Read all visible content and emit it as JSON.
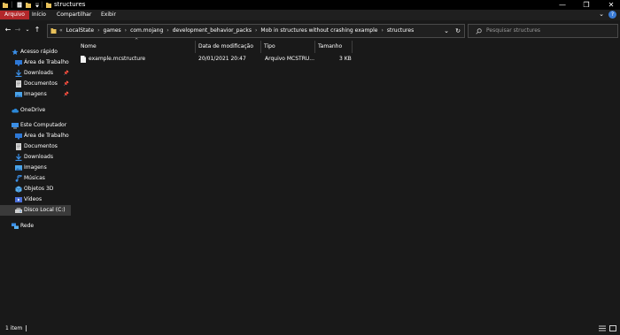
{
  "window": {
    "title": "structures",
    "controls": {
      "minimize": "—",
      "maximize": "❐",
      "close": "✕"
    }
  },
  "ribbon": {
    "tabs": [
      {
        "label": "Arquivo",
        "active": true
      },
      {
        "label": "Início"
      },
      {
        "label": "Compartilhar"
      },
      {
        "label": "Exibir"
      }
    ],
    "help_label": "?"
  },
  "nav": {
    "back": "←",
    "forward": "→",
    "recent": "⌄",
    "up": "↑",
    "dropdown": "⌄",
    "refresh": "↻",
    "breadcrumb": [
      "LocalState",
      "games",
      "com.mojang",
      "development_behavior_packs",
      "Mob in structures without crashing example",
      "structures"
    ],
    "search_placeholder": "Pesquisar structures"
  },
  "sidebar": {
    "quick_access": "Acesso rápido",
    "quick_items": [
      {
        "label": "Área de Trabalho",
        "icon": "desktop-icon"
      },
      {
        "label": "Downloads",
        "icon": "download-icon"
      },
      {
        "label": "Documentos",
        "icon": "documents-icon"
      },
      {
        "label": "Imagens",
        "icon": "pictures-icon"
      }
    ],
    "onedrive": "OneDrive",
    "this_pc": "Este Computador",
    "pc_items": [
      {
        "label": "Área de Trabalho",
        "icon": "desktop-icon"
      },
      {
        "label": "Documentos",
        "icon": "documents-icon"
      },
      {
        "label": "Downloads",
        "icon": "download-icon"
      },
      {
        "label": "Imagens",
        "icon": "pictures-icon"
      },
      {
        "label": "Músicas",
        "icon": "music-icon"
      },
      {
        "label": "Objetos 3D",
        "icon": "objects3d-icon"
      },
      {
        "label": "Vídeos",
        "icon": "videos-icon"
      },
      {
        "label": "Disco Local (C:)",
        "icon": "drive-icon",
        "selected": true
      }
    ],
    "network": "Rede"
  },
  "table": {
    "columns": [
      "Nome",
      "Data de modificação",
      "Tipo",
      "Tamanho"
    ],
    "rows": [
      {
        "name": "example.mcstructure",
        "modified": "20/01/2021 20:47",
        "type": "Arquivo MCSTRU...",
        "size": "3 KB"
      }
    ]
  },
  "status": {
    "count": "1 item"
  },
  "colors": {
    "accent": "#b3272a",
    "background": "#191919",
    "folder": "#e8c15a"
  }
}
